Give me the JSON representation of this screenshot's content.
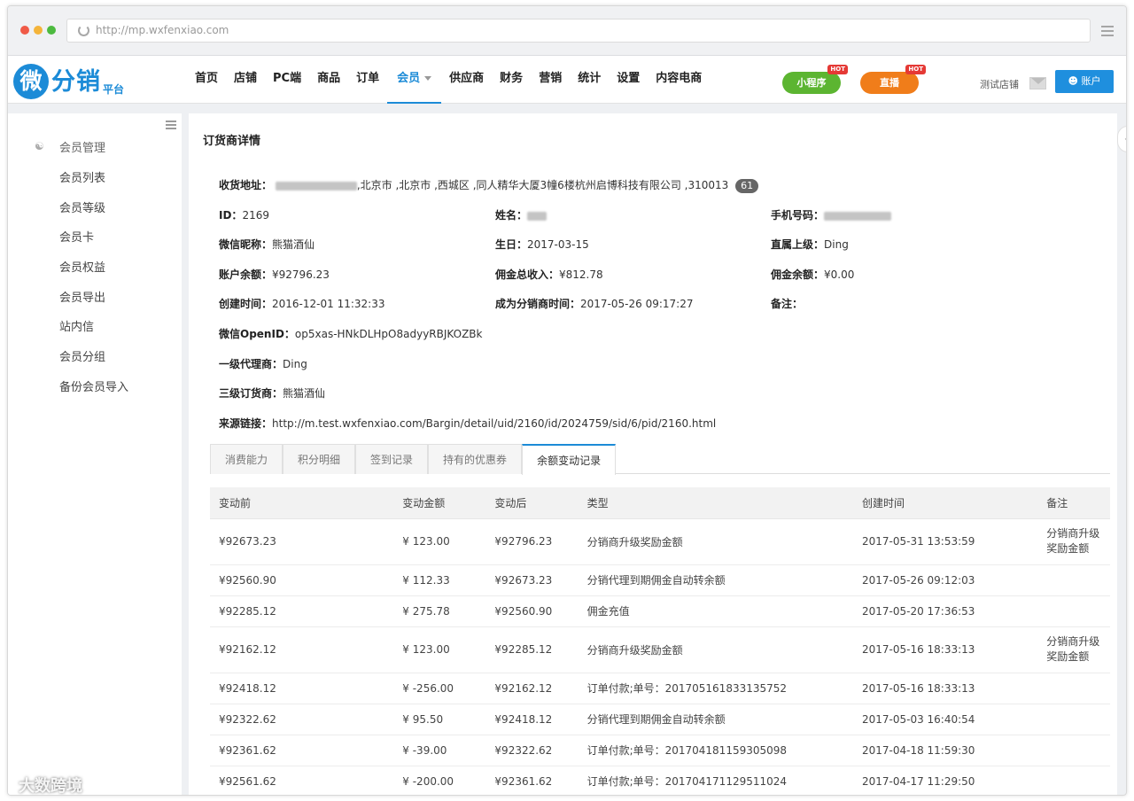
{
  "browser": {
    "url": "http://mp.wxfenxiao.com"
  },
  "logo": {
    "main": "分销",
    "glyph": "微",
    "sub": "平台"
  },
  "nav": {
    "items": [
      "首页",
      "店铺",
      "PC端",
      "商品",
      "订单",
      "会员",
      "供应商",
      "财务",
      "营销",
      "统计",
      "设置",
      "内容电商"
    ],
    "active": "会员",
    "mini_program": "小程序",
    "live": "直播",
    "hot_badge": "HOT",
    "shop_name": "测试店铺",
    "account": "账户"
  },
  "sidebar": {
    "title": "会员管理",
    "items": [
      "会员列表",
      "会员等级",
      "会员卡",
      "会员权益",
      "会员导出",
      "站内信",
      "会员分组",
      "备份会员导入"
    ]
  },
  "detail": {
    "page_title": "订货商详情",
    "address_label": "收货地址：",
    "address_value": ",北京市 ,北京市 ,西城区 ,同人精华大厦3幢6楼杭州启博科技有限公司 ,310013",
    "address_count": "61",
    "id_label": "ID：",
    "id_value": "2169",
    "name_label": "姓名：",
    "phone_label": "手机号码：",
    "nick_label": "微信昵称：",
    "nick_value": "熊猫酒仙",
    "birthday_label": "生日：",
    "birthday_value": "2017-03-15",
    "superior_label": "直属上级：",
    "superior_value": "Ding",
    "balance_label": "账户余额：",
    "balance_value": "¥92796.23",
    "commission_total_label": "佣金总收入：",
    "commission_total_value": "¥812.78",
    "commission_balance_label": "佣金余额：",
    "commission_balance_value": "¥0.00",
    "created_label": "创建时间：",
    "created_value": "2016-12-01 11:32:33",
    "became_label": "成为分销商时间：",
    "became_value": "2017-05-26 09:17:27",
    "remark_label": "备注：",
    "openid_label": "微信OpenID：",
    "openid_value": "op5xas-HNkDLHpO8adyyRBJKOZBk",
    "agent1_label": "一级代理商：",
    "agent1_value": "Ding",
    "dealer3_label": "三级订货商：",
    "dealer3_value": "熊猫酒仙",
    "source_label": "来源链接：",
    "source_value": "http://m.test.wxfenxiao.com/Bargin/detail/uid/2160/id/2024759/sid/6/pid/2160.html"
  },
  "tabs": [
    "消费能力",
    "积分明细",
    "签到记录",
    "持有的优惠券",
    "余额变动记录"
  ],
  "table": {
    "headers": [
      "变动前",
      "变动金额",
      "变动后",
      "类型",
      "创建时间",
      "备注"
    ],
    "rows": [
      [
        "¥92673.23",
        "¥ 123.00",
        "¥92796.23",
        "分销商升级奖励金额",
        "2017-05-31 13:53:59",
        "分销商升级奖励金额"
      ],
      [
        "¥92560.90",
        "¥ 112.33",
        "¥92673.23",
        "分销代理到期佣金自动转余额",
        "2017-05-26 09:12:03",
        ""
      ],
      [
        "¥92285.12",
        "¥ 275.78",
        "¥92560.90",
        "佣金充值",
        "2017-05-20 17:36:53",
        ""
      ],
      [
        "¥92162.12",
        "¥ 123.00",
        "¥92285.12",
        "分销商升级奖励金额",
        "2017-05-16 18:33:13",
        "分销商升级奖励金额"
      ],
      [
        "¥92418.12",
        "¥ -256.00",
        "¥92162.12",
        "订单付款;单号：201705161833135752",
        "2017-05-16 18:33:13",
        ""
      ],
      [
        "¥92322.62",
        "¥ 95.50",
        "¥92418.12",
        "分销代理到期佣金自动转余额",
        "2017-05-03 16:40:54",
        ""
      ],
      [
        "¥92361.62",
        "¥ -39.00",
        "¥92322.62",
        "订单付款;单号：201704181159305098",
        "2017-04-18 11:59:30",
        ""
      ],
      [
        "¥92561.62",
        "¥ -200.00",
        "¥92361.62",
        "订单付款;单号：201704171129511024",
        "2017-04-17 11:29:50",
        ""
      ]
    ]
  },
  "watermark": "大数跨境"
}
